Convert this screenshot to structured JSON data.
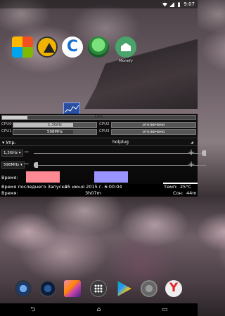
{
  "status_bar": {
    "time": "9:07"
  },
  "home_apps": [
    {
      "name": "microsoft-store",
      "label": ""
    },
    {
      "name": "aimp",
      "label": ""
    },
    {
      "name": "ccleaner",
      "label": ""
    },
    {
      "name": "tuneup",
      "label": ""
    },
    {
      "name": "money",
      "label": "Monefy"
    }
  ],
  "widget": {
    "total_percent": "13%",
    "total_fraction": 0.13,
    "cpus": [
      {
        "label": "CPU0",
        "value": "1,3GHz",
        "fraction": 0.72
      },
      {
        "label": "CPU1",
        "value": "598MHz",
        "fraction": 0.72
      },
      {
        "label": "CPU2",
        "value": "отключено",
        "fraction": 0
      },
      {
        "label": "CPU3",
        "value": "отключено",
        "fraction": 0
      }
    ],
    "governor": {
      "manage_label": "Упр.",
      "value": "hotplug"
    },
    "freq_max": {
      "value": "1,3GHz",
      "level": 1.0
    },
    "freq_min": {
      "value": "598MHz",
      "level": 0.0
    },
    "time_label": "Время:",
    "time_colors": [
      "#ff8a94",
      "#9a94ff"
    ],
    "last_start_label": "Время последнего Запуска",
    "last_start_value": "05 июня 2015 г. 6:00:04",
    "temp_label": "Темп:",
    "temp_value": "25°C",
    "uptime_label": "Время:",
    "uptime_value": "3h07m",
    "sleep_label": "Сон:",
    "sleep_value": "44m"
  }
}
